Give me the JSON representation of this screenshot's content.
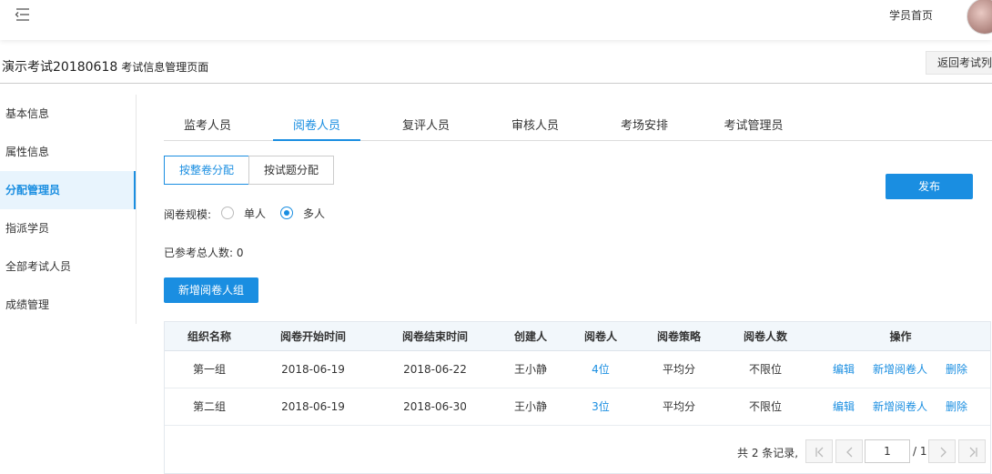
{
  "header": {
    "home_link": "学员首页"
  },
  "title": {
    "exam_name": "演示考试20180618",
    "page_name": "考试信息管理页面",
    "back_button": "返回考试列表"
  },
  "sidebar": {
    "items": [
      {
        "label": "基本信息",
        "active": false
      },
      {
        "label": "属性信息",
        "active": false
      },
      {
        "label": "分配管理员",
        "active": true
      },
      {
        "label": "指派学员",
        "active": false
      },
      {
        "label": "全部考试人员",
        "active": false
      },
      {
        "label": "成绩管理",
        "active": false
      }
    ]
  },
  "tabs": [
    {
      "label": "监考人员",
      "active": false
    },
    {
      "label": "阅卷人员",
      "active": true
    },
    {
      "label": "复评人员",
      "active": false
    },
    {
      "label": "审核人员",
      "active": false
    },
    {
      "label": "考场安排",
      "active": false
    },
    {
      "label": "考试管理员",
      "active": false
    }
  ],
  "assign_mode": {
    "options": [
      "按整卷分配",
      "按试题分配"
    ],
    "selected": "按整卷分配"
  },
  "publish_button": "发布",
  "scale": {
    "label": "阅卷规模:",
    "options": [
      "单人",
      "多人"
    ],
    "selected": "多人"
  },
  "participants": {
    "label": "已参考总人数:",
    "value": "0"
  },
  "add_group_button": "新增阅卷人组",
  "table": {
    "columns": [
      "组织名称",
      "阅卷开始时间",
      "阅卷结束时间",
      "创建人",
      "阅卷人",
      "阅卷策略",
      "阅卷人数",
      "操作"
    ],
    "rows": [
      {
        "name": "第一组",
        "start": "2018-06-19",
        "end": "2018-06-22",
        "creator": "王小静",
        "graders": "4位",
        "strategy": "平均分",
        "count": "不限位",
        "actions": [
          "编辑",
          "新增阅卷人",
          "删除"
        ]
      },
      {
        "name": "第二组",
        "start": "2018-06-19",
        "end": "2018-06-30",
        "creator": "王小静",
        "graders": "3位",
        "strategy": "平均分",
        "count": "不限位",
        "actions": [
          "编辑",
          "新增阅卷人",
          "删除"
        ]
      }
    ]
  },
  "pagination": {
    "total_text": "共 2 条记录,",
    "current_page": "1",
    "total_pages": "/ 1"
  },
  "colors": {
    "accent": "#1a8ee1",
    "header_bg": "#f2f7fb",
    "active_side_bg": "#e8f4fd"
  }
}
